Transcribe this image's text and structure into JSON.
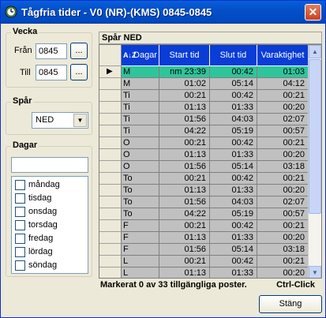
{
  "window": {
    "title": "Tågfria tider - V0 (NR)-(KMS) 0845-0845",
    "close_glyph": "✕"
  },
  "vecka": {
    "label": "Vecka",
    "fran_label": "Från",
    "fran_value": "0845",
    "till_label": "Till",
    "till_value": "0845",
    "browse_label": "..."
  },
  "spar": {
    "label": "Spår",
    "selected": "NED"
  },
  "dagar": {
    "label": "Dagar",
    "filter_value": "",
    "days": [
      {
        "label": "måndag",
        "checked": false
      },
      {
        "label": "tisdag",
        "checked": false
      },
      {
        "label": "onsdag",
        "checked": false
      },
      {
        "label": "torsdag",
        "checked": false
      },
      {
        "label": "fredag",
        "checked": false
      },
      {
        "label": "lördag",
        "checked": false
      },
      {
        "label": "söndag",
        "checked": false
      }
    ]
  },
  "grid": {
    "caption": "Spår NED",
    "sort_icon": "A↓Z",
    "columns": [
      "Dagar",
      "Start tid",
      "Slut tid",
      "Varaktighet"
    ],
    "current_row_marker": "▶",
    "rows": [
      {
        "dag": "M",
        "start": "nm 23:39",
        "slut": "00:42",
        "var": "01:03",
        "active": true
      },
      {
        "dag": "M",
        "start": "01:02",
        "slut": "05:14",
        "var": "04:12"
      },
      {
        "dag": "Ti",
        "start": "00:21",
        "slut": "00:42",
        "var": "00:21"
      },
      {
        "dag": "Ti",
        "start": "01:13",
        "slut": "01:33",
        "var": "00:20"
      },
      {
        "dag": "Ti",
        "start": "01:56",
        "slut": "04:03",
        "var": "02:07"
      },
      {
        "dag": "Ti",
        "start": "04:22",
        "slut": "05:19",
        "var": "00:57"
      },
      {
        "dag": "O",
        "start": "00:21",
        "slut": "00:42",
        "var": "00:21"
      },
      {
        "dag": "O",
        "start": "01:13",
        "slut": "01:33",
        "var": "00:20"
      },
      {
        "dag": "O",
        "start": "01:56",
        "slut": "05:14",
        "var": "03:18"
      },
      {
        "dag": "To",
        "start": "00:21",
        "slut": "00:42",
        "var": "00:21"
      },
      {
        "dag": "To",
        "start": "01:13",
        "slut": "01:33",
        "var": "00:20"
      },
      {
        "dag": "To",
        "start": "01:56",
        "slut": "04:03",
        "var": "02:07"
      },
      {
        "dag": "To",
        "start": "04:22",
        "slut": "05:19",
        "var": "00:57"
      },
      {
        "dag": "F",
        "start": "00:21",
        "slut": "00:42",
        "var": "00:21"
      },
      {
        "dag": "F",
        "start": "01:13",
        "slut": "01:33",
        "var": "00:20"
      },
      {
        "dag": "F",
        "start": "01:56",
        "slut": "05:14",
        "var": "03:18"
      },
      {
        "dag": "L",
        "start": "00:21",
        "slut": "00:42",
        "var": "00:21"
      },
      {
        "dag": "L",
        "start": "01:13",
        "slut": "01:33",
        "var": "00:20"
      }
    ]
  },
  "status": {
    "text": "Markerat 0 av  33 tillgängliga poster.",
    "hint": "Ctrl-Click"
  },
  "footer": {
    "close_label": "Stäng"
  },
  "colors": {
    "title_bar": "#0250c9",
    "header_bg": "#0a3cd6",
    "active_row": "#2fc59b",
    "cell_bg": "#c0c0c0"
  }
}
